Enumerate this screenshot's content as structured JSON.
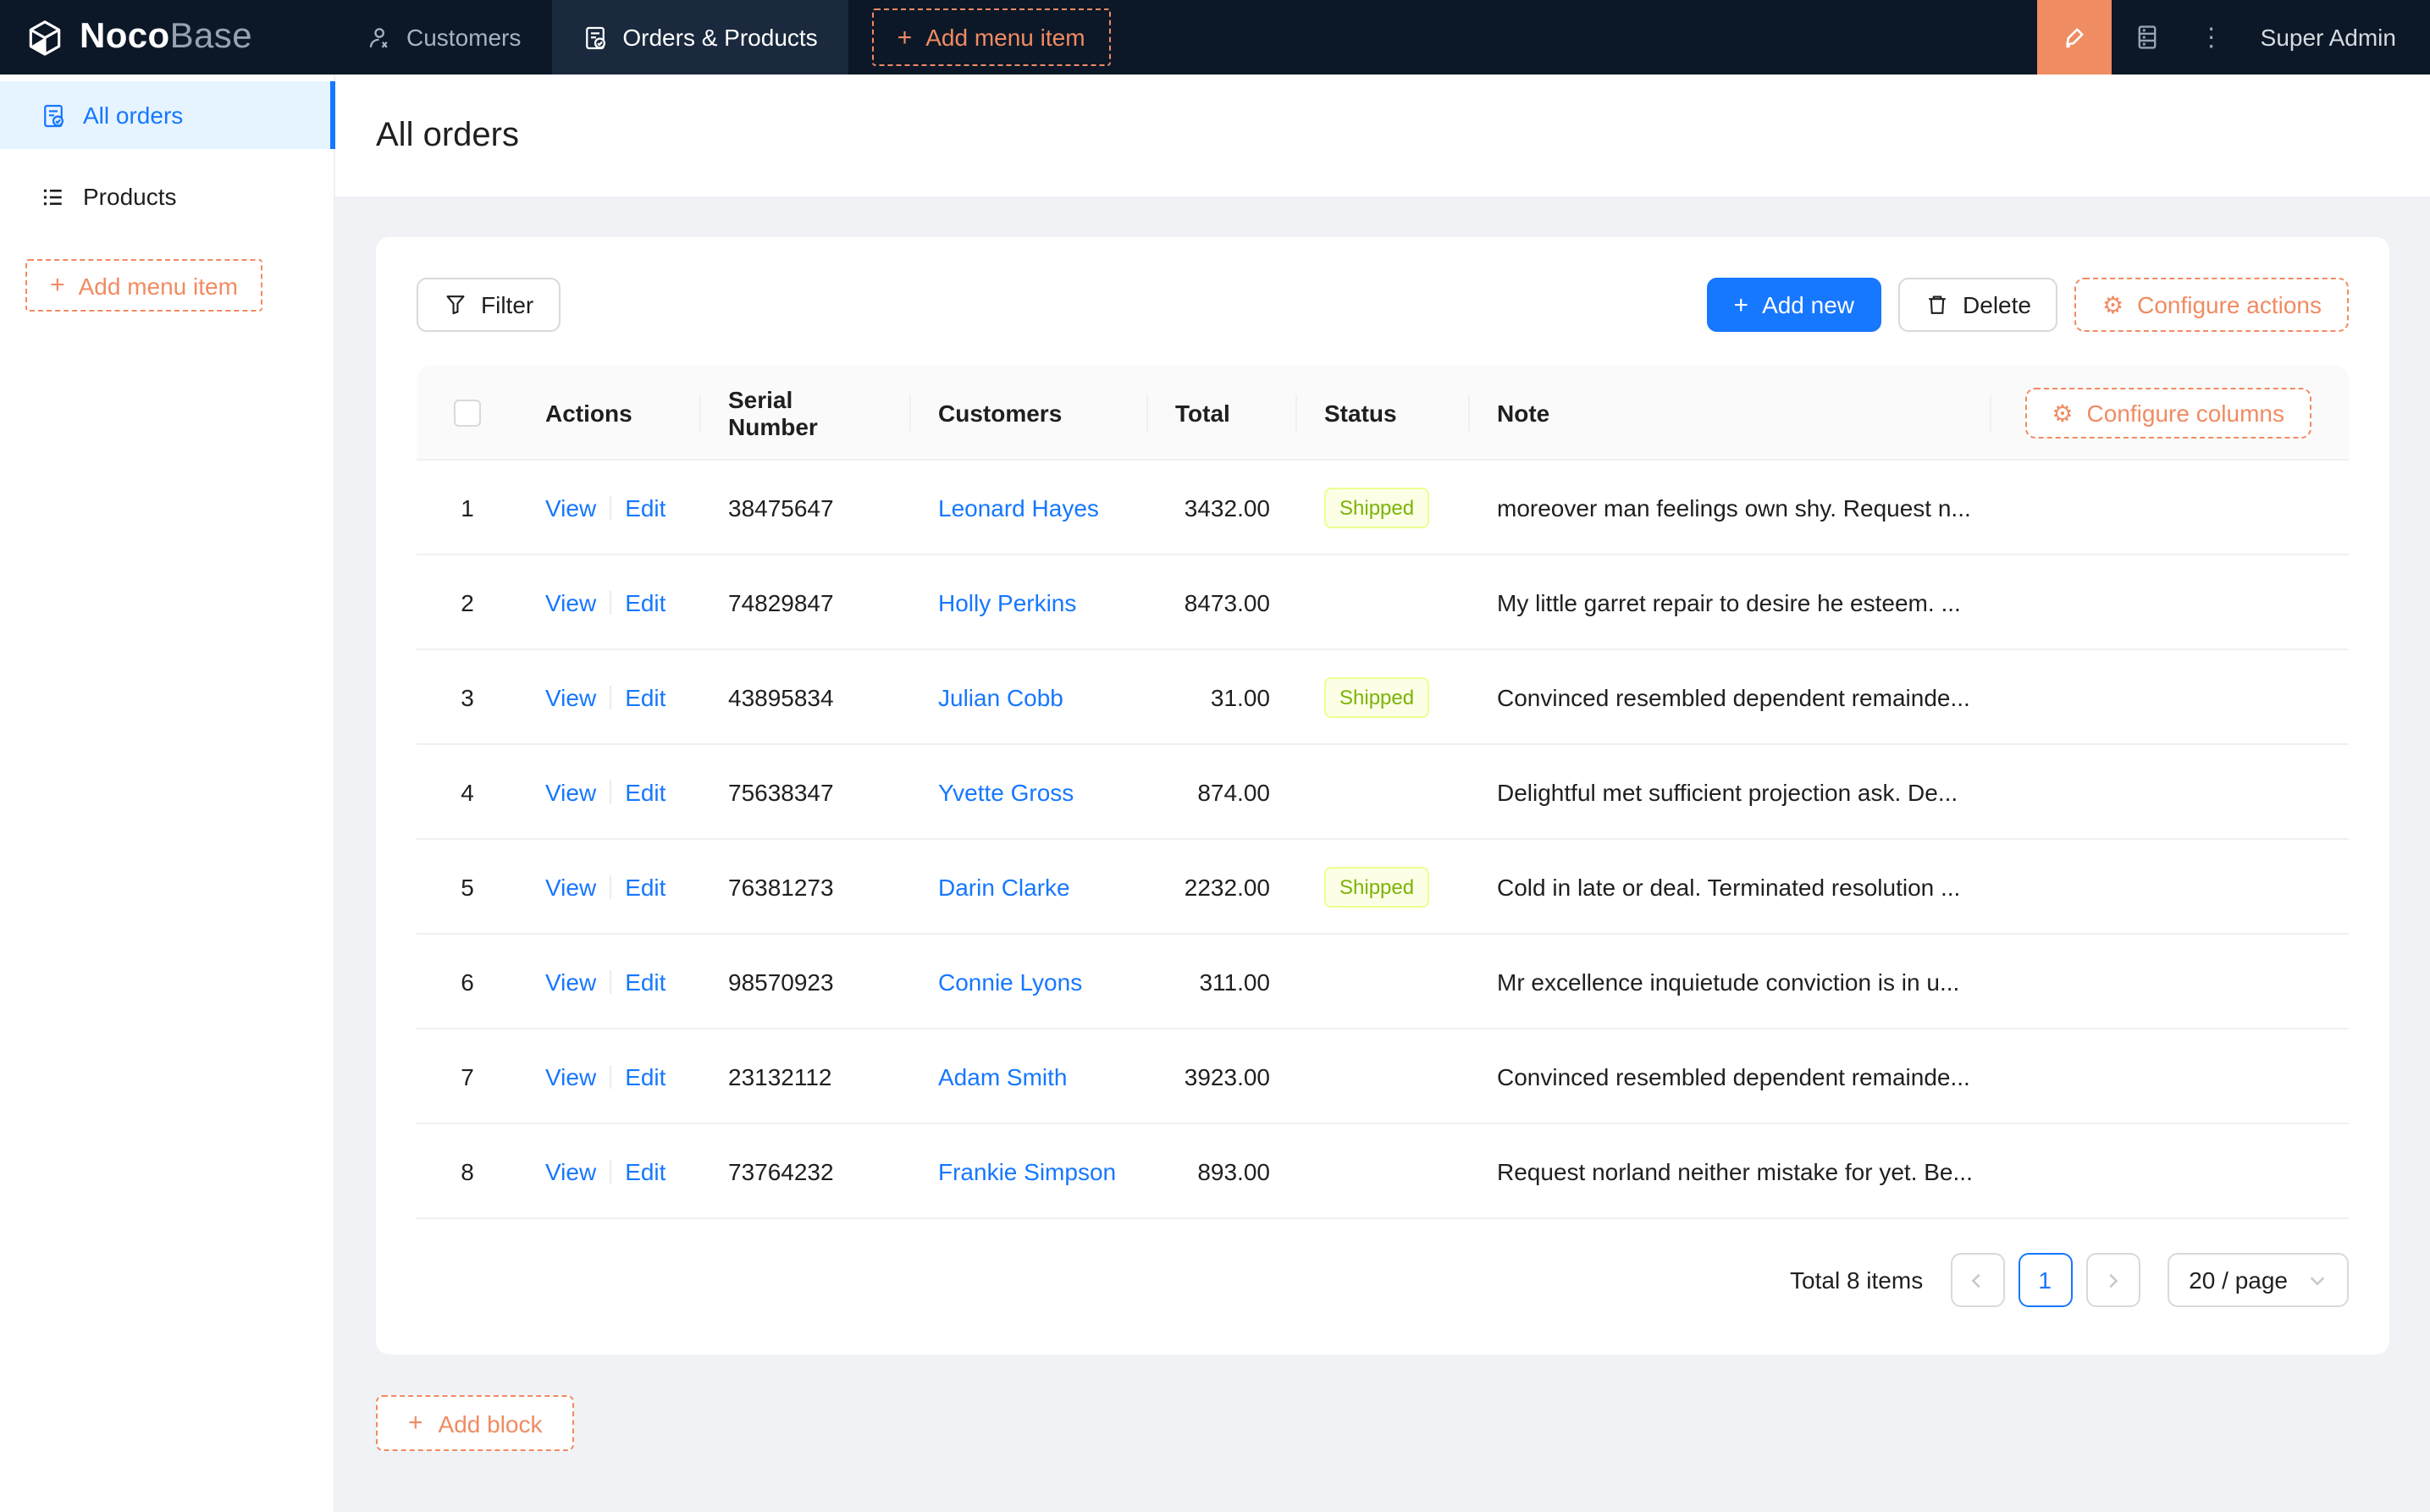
{
  "colors": {
    "nav_bg": "#0c1828",
    "nav_active_tab_bg": "#1a293d",
    "accent_orange": "#f18b62",
    "designer_btn_bg": "#f08c62",
    "primary_blue": "#1677ff",
    "menu_selected_bg": "#e6f4ff",
    "page_bg": "#f0f2f5",
    "table_header_bg": "#fafafa",
    "tag_lime_bg": "#fcffe6",
    "tag_lime_border": "#eaff8f",
    "tag_lime_text": "#7cb305"
  },
  "icons": {
    "plus": "+",
    "ellipsis": "⋮",
    "gear": "⚙"
  },
  "topnav": {
    "logo_bold": "Noco",
    "logo_light": "Base",
    "tabs": [
      {
        "label": "Customers"
      },
      {
        "label": "Orders & Products"
      }
    ],
    "add_menu_item_label": "Add menu item",
    "user_name": "Super Admin"
  },
  "sidebar": {
    "items": [
      {
        "label": "All orders"
      },
      {
        "label": "Products"
      }
    ],
    "add_menu_item_label": "Add menu item"
  },
  "page": {
    "title": "All orders"
  },
  "toolbar": {
    "filter_label": "Filter",
    "add_new_label": "Add new",
    "delete_label": "Delete",
    "configure_actions_label": "Configure actions"
  },
  "table": {
    "configure_columns_label": "Configure columns",
    "columns": {
      "actions": "Actions",
      "serial": "Serial Number",
      "customers": "Customers",
      "total": "Total",
      "status": "Status",
      "note": "Note"
    },
    "action_labels": {
      "view": "View",
      "edit": "Edit"
    },
    "rows": [
      {
        "index": "1",
        "serial": "38475647",
        "customer": "Leonard Hayes",
        "total": "3432.00",
        "status": "Shipped",
        "note": "moreover man feelings own shy. Request n..."
      },
      {
        "index": "2",
        "serial": "74829847",
        "customer": "Holly Perkins",
        "total": "8473.00",
        "status": "",
        "note": "My little garret repair to desire he esteem. ..."
      },
      {
        "index": "3",
        "serial": "43895834",
        "customer": "Julian Cobb",
        "total": "31.00",
        "status": "Shipped",
        "note": "Convinced resembled dependent remainde..."
      },
      {
        "index": "4",
        "serial": "75638347",
        "customer": "Yvette Gross",
        "total": "874.00",
        "status": "",
        "note": "Delightful met sufficient projection ask. De..."
      },
      {
        "index": "5",
        "serial": "76381273",
        "customer": "Darin Clarke",
        "total": "2232.00",
        "status": "Shipped",
        "note": "Cold in late or deal. Terminated resolution ..."
      },
      {
        "index": "6",
        "serial": "98570923",
        "customer": "Connie Lyons",
        "total": "311.00",
        "status": "",
        "note": "Mr excellence inquietude conviction is in u..."
      },
      {
        "index": "7",
        "serial": "23132112",
        "customer": "Adam Smith",
        "total": "3923.00",
        "status": "",
        "note": "Convinced resembled dependent remainde..."
      },
      {
        "index": "8",
        "serial": "73764232",
        "customer": "Frankie Simpson",
        "total": "893.00",
        "status": "",
        "note": "Request norland neither mistake for yet. Be..."
      }
    ]
  },
  "pagination": {
    "total_text": "Total 8 items",
    "current_page": "1",
    "page_size": "20 / page"
  },
  "add_block_label": "Add block"
}
